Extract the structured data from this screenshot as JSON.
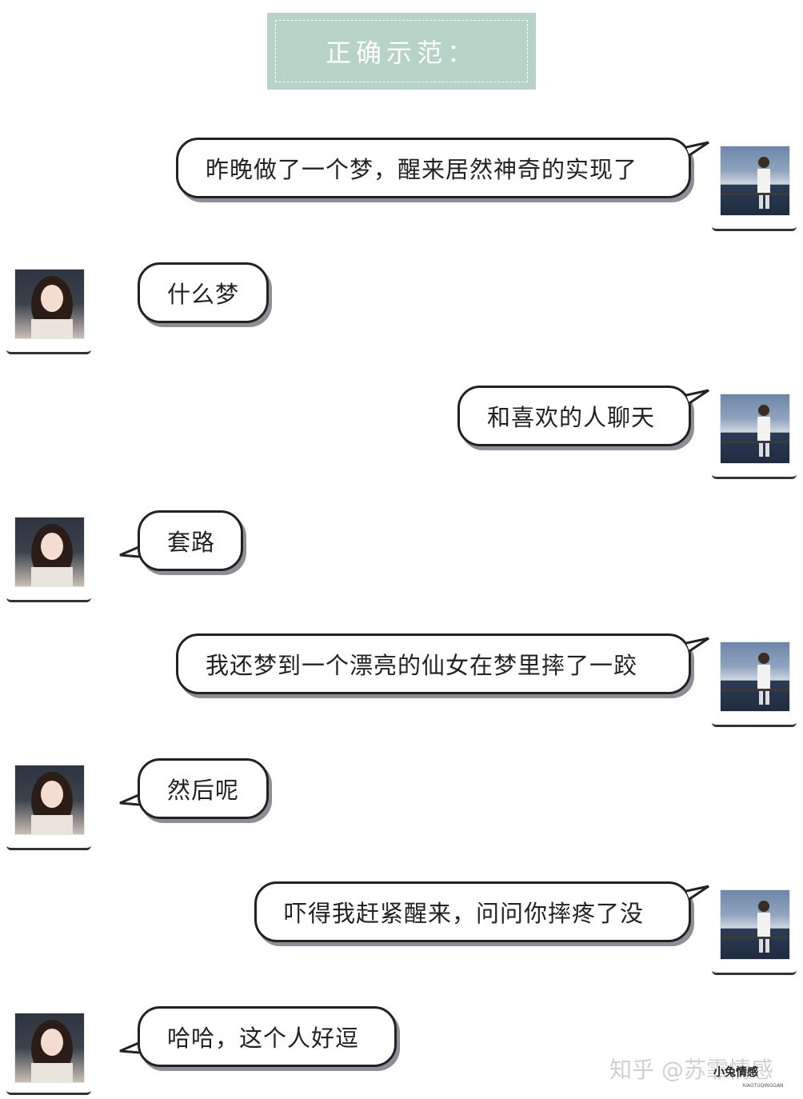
{
  "banner": {
    "title": "正确示范："
  },
  "messages": [
    {
      "side": "right",
      "text": "昨晚做了一个梦，醒来居然神奇的实现了"
    },
    {
      "side": "left",
      "text": "什么梦"
    },
    {
      "side": "right",
      "text": "和喜欢的人聊天"
    },
    {
      "side": "left",
      "text": "套路"
    },
    {
      "side": "right",
      "text": "我还梦到一个漂亮的仙女在梦里摔了一跤"
    },
    {
      "side": "left",
      "text": "然后呢"
    },
    {
      "side": "right",
      "text": "吓得我赶紧醒来，问问你摔疼了没"
    },
    {
      "side": "left",
      "text": "哈哈，这个人好逗"
    }
  ],
  "watermark": {
    "text": "知乎 @苏霏情感"
  },
  "logo": {
    "text": "小兔情感",
    "sub": "XIAOTUQINGGAN"
  }
}
